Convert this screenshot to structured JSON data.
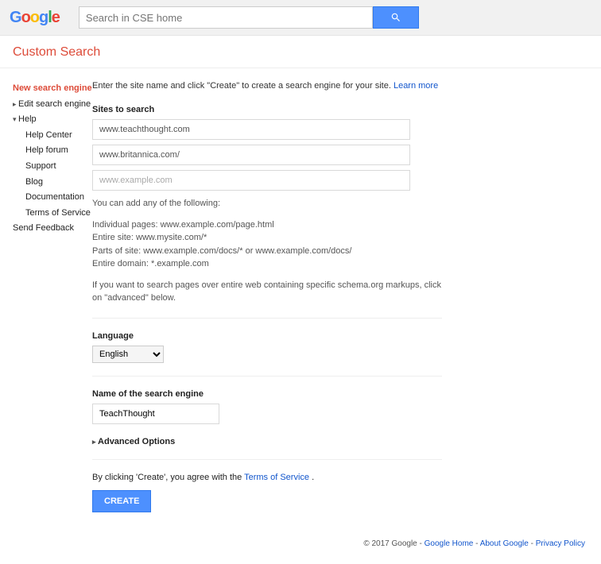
{
  "header": {
    "search_placeholder": "Search in CSE home",
    "product_title": "Custom Search"
  },
  "sidebar": {
    "new_engine": "New search engine",
    "edit_engine": "Edit search engine",
    "help": "Help",
    "help_items": {
      "center": "Help Center",
      "forum": "Help forum",
      "support": "Support",
      "blog": "Blog",
      "docs": "Documentation",
      "tos": "Terms of Service"
    },
    "send_feedback": "Send Feedback"
  },
  "main": {
    "instruction": "Enter the site name and click \"Create\" to create a search engine for your site. ",
    "learn_more": "Learn more",
    "sites_label": "Sites to search",
    "site_values": {
      "s1": "www.teachthought.com",
      "s2": "www.britannica.com/"
    },
    "site_placeholder": "www.example.com",
    "help_intro": "You can add any of the following:",
    "help_lines": "Individual pages: www.example.com/page.html\nEntire site: www.mysite.com/*\nParts of site: www.example.com/docs/* or www.example.com/docs/\nEntire domain: *.example.com",
    "help_schema": "If you want to search pages over entire web containing specific schema.org markups, click on \"advanced\" below.",
    "language_label": "Language",
    "language_value": "English",
    "name_label": "Name of the search engine",
    "name_value": "TeachThought",
    "advanced": "Advanced Options",
    "agree_prefix": "By clicking 'Create', you agree with the ",
    "agree_link": "Terms of Service",
    "agree_suffix": " .",
    "create": "CREATE"
  },
  "footer": {
    "copyright": "© 2017 Google",
    "sep": " - ",
    "home": "Google Home",
    "about": "About Google",
    "privacy": "Privacy Policy"
  }
}
